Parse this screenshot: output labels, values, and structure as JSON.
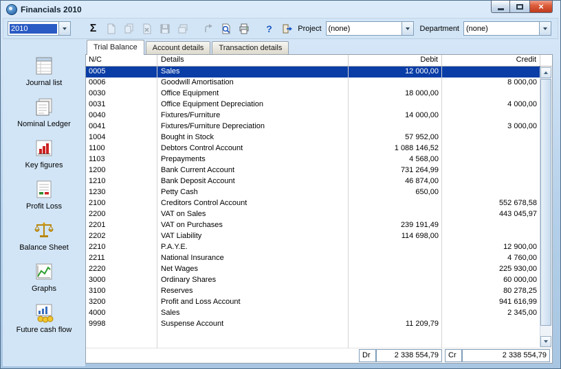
{
  "window": {
    "title": "Financials 2010"
  },
  "toolbar": {
    "year_value": "2010",
    "icons": [
      "sum-icon",
      "new-document-icon",
      "copy-icon",
      "delete-icon",
      "save-icon",
      "layers-icon",
      "undo-icon",
      "print-preview-icon",
      "print-icon",
      "help-icon",
      "exit-icon"
    ],
    "project_label": "Project",
    "project_value": "(none)",
    "department_label": "Department",
    "department_value": "(none)"
  },
  "sidebar": {
    "items": [
      {
        "label": "Journal list"
      },
      {
        "label": "Nominal Ledger"
      },
      {
        "label": "Key figures"
      },
      {
        "label": "Profit Loss"
      },
      {
        "label": "Balance Sheet"
      },
      {
        "label": "Graphs"
      },
      {
        "label": "Future cash flow"
      }
    ]
  },
  "tabs": [
    {
      "label": "Trial Balance",
      "active": true
    },
    {
      "label": "Account details",
      "active": false
    },
    {
      "label": "Transaction details",
      "active": false
    }
  ],
  "table": {
    "columns": [
      "N/C",
      "Details",
      "Debit",
      "Credit"
    ],
    "rows": [
      {
        "nc": "0005",
        "details": "Sales",
        "debit": "12 000,00",
        "credit": "",
        "selected": true
      },
      {
        "nc": "0006",
        "details": "Goodwill Amortisation",
        "debit": "",
        "credit": "8 000,00"
      },
      {
        "nc": "0030",
        "details": "Office Equipment",
        "debit": "18 000,00",
        "credit": ""
      },
      {
        "nc": "0031",
        "details": "Office Equipment Depreciation",
        "debit": "",
        "credit": "4 000,00"
      },
      {
        "nc": "0040",
        "details": "Fixtures/Furniture",
        "debit": "14 000,00",
        "credit": ""
      },
      {
        "nc": "0041",
        "details": "Fixtures/Furniture Depreciation",
        "debit": "",
        "credit": "3 000,00"
      },
      {
        "nc": "1004",
        "details": "Bought in Stock",
        "debit": "57 952,00",
        "credit": ""
      },
      {
        "nc": "1100",
        "details": "Debtors Control Account",
        "debit": "1 088 146,52",
        "credit": ""
      },
      {
        "nc": "1103",
        "details": "Prepayments",
        "debit": "4 568,00",
        "credit": ""
      },
      {
        "nc": "1200",
        "details": "Bank Current Account",
        "debit": "731 264,99",
        "credit": ""
      },
      {
        "nc": "1210",
        "details": "Bank Deposit Account",
        "debit": "46 874,00",
        "credit": ""
      },
      {
        "nc": "1230",
        "details": "Petty Cash",
        "debit": "650,00",
        "credit": ""
      },
      {
        "nc": "2100",
        "details": "Creditors Control Account",
        "debit": "",
        "credit": "552 678,58"
      },
      {
        "nc": "2200",
        "details": "VAT on Sales",
        "debit": "",
        "credit": "443 045,97"
      },
      {
        "nc": "2201",
        "details": "VAT on Purchases",
        "debit": "239 191,49",
        "credit": ""
      },
      {
        "nc": "2202",
        "details": "VAT Liability",
        "debit": "114 698,00",
        "credit": ""
      },
      {
        "nc": "2210",
        "details": "P.A.Y.E.",
        "debit": "",
        "credit": "12 900,00"
      },
      {
        "nc": "2211",
        "details": "National Insurance",
        "debit": "",
        "credit": "4 760,00"
      },
      {
        "nc": "2220",
        "details": "Net Wages",
        "debit": "",
        "credit": "225 930,00"
      },
      {
        "nc": "3000",
        "details": "Ordinary Shares",
        "debit": "",
        "credit": "60 000,00"
      },
      {
        "nc": "3100",
        "details": "Reserves",
        "debit": "",
        "credit": "80 278,25"
      },
      {
        "nc": "3200",
        "details": "Profit and Loss Account",
        "debit": "",
        "credit": "941 616,99"
      },
      {
        "nc": "4000",
        "details": "Sales",
        "debit": "",
        "credit": "2 345,00"
      },
      {
        "nc": "9998",
        "details": "Suspense Account",
        "debit": "11 209,79",
        "credit": ""
      }
    ]
  },
  "totals": {
    "dr_label": "Dr",
    "dr_value": "2 338 554,79",
    "cr_label": "Cr",
    "cr_value": "2 338 554,79"
  },
  "colors": {
    "selection": "#0a3da6",
    "window_bg": "#d2e5f6",
    "close_button": "#bf3a1d"
  }
}
